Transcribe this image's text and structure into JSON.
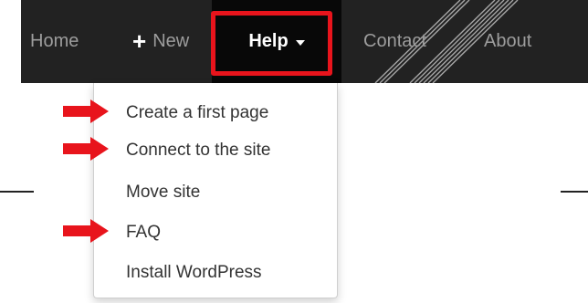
{
  "navbar": {
    "home_label": "Home",
    "new_label": "New",
    "help_label": "Help",
    "contact_label": "Contact",
    "about_label": "About"
  },
  "help_menu": {
    "items": [
      {
        "label": "Create a first page",
        "highlighted": true
      },
      {
        "label": "Connect to the site",
        "highlighted": true
      },
      {
        "label": "Move site",
        "highlighted": false
      },
      {
        "label": "FAQ",
        "highlighted": true
      },
      {
        "label": "Install WordPress",
        "highlighted": false
      }
    ]
  },
  "annotations": {
    "highlight_color": "#e8141c",
    "arrow_icon": "right-arrow-icon"
  },
  "colors": {
    "navbar_bg": "#222222",
    "active_tab_bg": "#080808",
    "nav_text": "#9d9d9d",
    "menu_text": "#333333"
  }
}
